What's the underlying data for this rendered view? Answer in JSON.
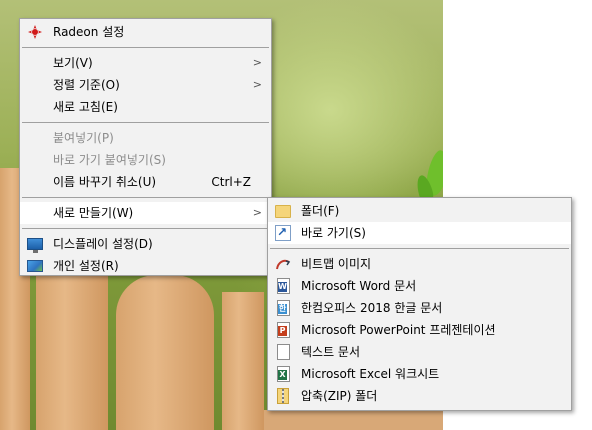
{
  "context_menu": {
    "items": [
      {
        "label": "Radeon 설정"
      },
      {
        "label": "보기(V)"
      },
      {
        "label": "정렬 기준(O)"
      },
      {
        "label": "새로 고침(E)"
      },
      {
        "label": "붙여넣기(P)"
      },
      {
        "label": "바로 가기 붙여넣기(S)"
      },
      {
        "label": "이름 바꾸기 취소(U)",
        "shortcut": "Ctrl+Z"
      },
      {
        "label": "새로 만들기(W)"
      },
      {
        "label": "디스플레이 설정(D)"
      },
      {
        "label": "개인 설정(R)"
      }
    ],
    "submenu_arrow": ">"
  },
  "new_submenu": {
    "items": [
      {
        "label": "폴더(F)",
        "icon": "folder-icon"
      },
      {
        "label": "바로 가기(S)",
        "icon": "shortcut-icon"
      },
      {
        "label": "비트맵 이미지",
        "icon": "bitmap-icon"
      },
      {
        "label": "Microsoft Word 문서",
        "icon": "word-icon"
      },
      {
        "label": "한컴오피스 2018 한글 문서",
        "icon": "hwp-icon"
      },
      {
        "label": "Microsoft PowerPoint 프레젠테이션",
        "icon": "powerpoint-icon"
      },
      {
        "label": "텍스트 문서",
        "icon": "text-document-icon"
      },
      {
        "label": "Microsoft Excel 워크시트",
        "icon": "excel-icon"
      },
      {
        "label": "압축(ZIP) 폴더",
        "icon": "zip-folder-icon"
      }
    ]
  },
  "icon_letters": {
    "word": "W",
    "hwp": "한",
    "powerpoint": "P",
    "excel": "X"
  },
  "colors": {
    "menu_background": "#f2f2f2",
    "menu_border": "#a0a0a0",
    "highlight": "#ffffff",
    "disabled_text": "#8d8d8d"
  }
}
